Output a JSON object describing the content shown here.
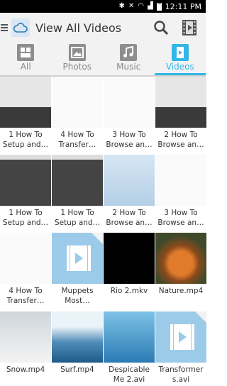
{
  "status_bar": {
    "time": "12:11 PM"
  },
  "header": {
    "title": "View All Videos"
  },
  "tabs": [
    {
      "label": "All",
      "icon": "all-icon",
      "active": false
    },
    {
      "label": "Photos",
      "icon": "photos-icon",
      "active": false
    },
    {
      "label": "Music",
      "icon": "music-icon",
      "active": false
    },
    {
      "label": "Videos",
      "icon": "videos-icon",
      "active": true
    }
  ],
  "videos": [
    {
      "label": "1 How To\nSetup and…",
      "thumb": "grey"
    },
    {
      "label": "4 How To\nTransfer…",
      "thumb": "white"
    },
    {
      "label": "3 How To\nBrowse an…",
      "thumb": "white"
    },
    {
      "label": "2 How To\nBrowse an…",
      "thumb": "grey"
    },
    {
      "label": "1 How To\nSetup and…",
      "thumb": "dark"
    },
    {
      "label": "1 How To\nSetup and…",
      "thumb": "dark"
    },
    {
      "label": "2 How To\nBrowse an…",
      "thumb": "blue"
    },
    {
      "label": "3 How To\nBrowse an…",
      "thumb": "white"
    },
    {
      "label": "4 How To\nTransfer…",
      "thumb": "white"
    },
    {
      "label": "Muppets\nMost…",
      "thumb": "video-icon"
    },
    {
      "label": "Rio 2.mkv",
      "thumb": "black"
    },
    {
      "label": "Nature.mp4",
      "thumb": "fox"
    },
    {
      "label": "Snow.mp4",
      "thumb": "snow"
    },
    {
      "label": "Surf.mp4",
      "thumb": "surf"
    },
    {
      "label": "Despicable\nMe 2.avi",
      "thumb": "desp"
    },
    {
      "label": "Transformer\ns.avi",
      "thumb": "video-icon"
    }
  ],
  "colors": {
    "accent": "#33b5e5"
  }
}
